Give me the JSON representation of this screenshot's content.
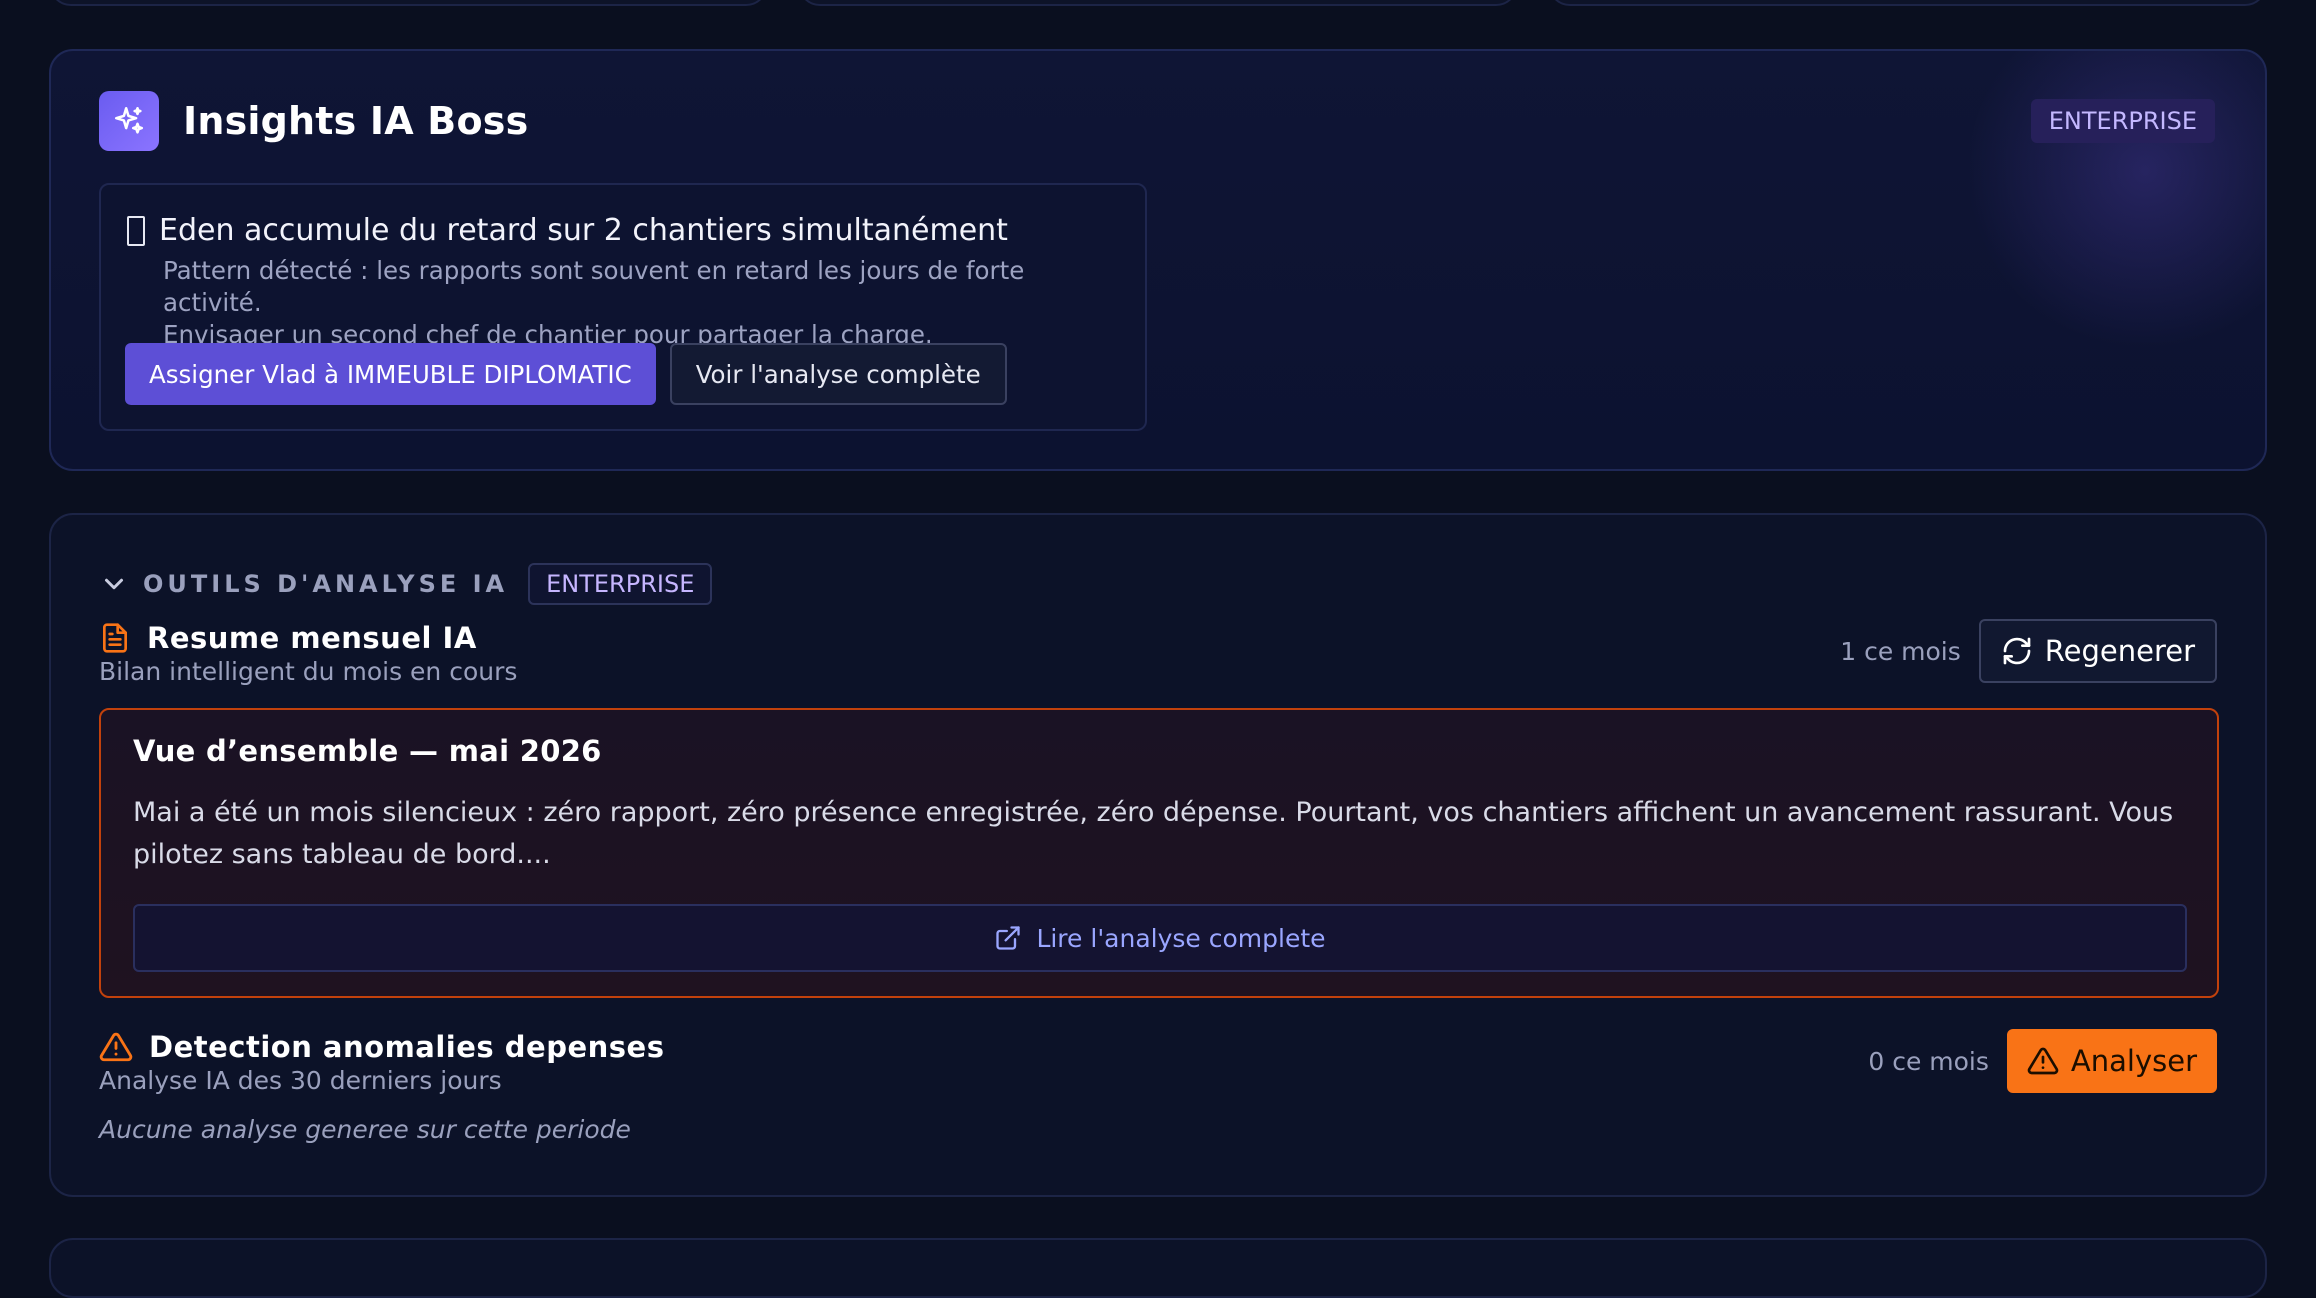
{
  "insights": {
    "title": "Insights IA Boss",
    "badge": "ENTERPRISE",
    "item": {
      "title": "Eden accumule du retard sur 2 chantiers simultanément",
      "description_line1": "Pattern détecté : les rapports sont souvent en retard les jours de forte activité.",
      "description_line2": "Envisager un second chef de chantier pour partager la charge.",
      "primary_action": "Assigner Vlad à IMMEUBLE DIPLOMATIC",
      "secondary_action": "Voir l'analyse complète"
    }
  },
  "tools": {
    "label": "OUTILS D'ANALYSE IA",
    "badge": "ENTERPRISE",
    "monthly_summary": {
      "title": "Resume mensuel IA",
      "subtitle": "Bilan intelligent du mois en cours",
      "count": "1 ce mois",
      "button": "Regenerer",
      "overview": {
        "title": "Vue d’ensemble — mai 2026",
        "text": "Mai a été un mois silencieux : zéro rapport, zéro présence enregistrée, zéro dépense. Pourtant, vos chantiers affichent un avancement rassurant. Vous pilotez sans tableau de bord....",
        "read_full": "Lire l'analyse complete"
      }
    },
    "anomalies": {
      "title": "Detection anomalies depenses",
      "subtitle": "Analyse IA des 30 derniers jours",
      "count": "0 ce mois",
      "button": "Analyser",
      "empty": "Aucune analyse generee sur cette periode"
    }
  },
  "icons": {
    "insights": "sparkles-icon",
    "chevron": "chevron-down-icon",
    "summary": "file-text-icon",
    "regen": "refresh-icon",
    "external": "external-link-icon",
    "warning": "alert-triangle-icon"
  },
  "colors": {
    "accent": "#5d4fd6",
    "warning": "#f97316",
    "overview_border": "#c2410c"
  }
}
